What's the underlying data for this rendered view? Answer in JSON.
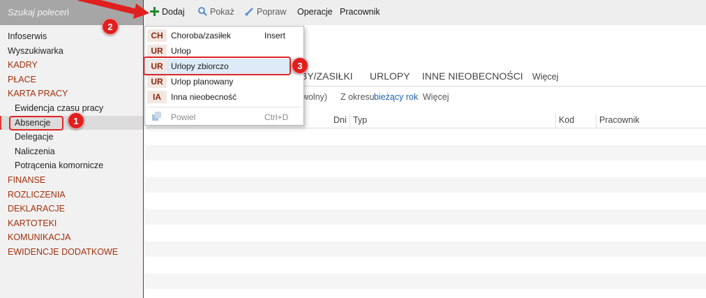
{
  "search": {
    "placeholder": "Szukaj poleceń"
  },
  "sidebar": {
    "items": [
      {
        "label": "Infoserwis"
      },
      {
        "label": "Wyszukiwarka"
      },
      {
        "label": "KADRY"
      },
      {
        "label": "PŁACE"
      },
      {
        "label": "KARTA PRACY"
      },
      {
        "label": "Ewidencja czasu pracy"
      },
      {
        "label": "Absencje"
      },
      {
        "label": "Delegacje"
      },
      {
        "label": "Naliczenia"
      },
      {
        "label": "Potrącenia komornicze"
      },
      {
        "label": "FINANSE"
      },
      {
        "label": "ROZLICZENIA"
      },
      {
        "label": "DEKLARACJE"
      },
      {
        "label": "KARTOTEKI"
      },
      {
        "label": "KOMUNIKACJA"
      },
      {
        "label": "EWIDENCJE DODATKOWE"
      }
    ]
  },
  "toolbar": {
    "add_label": "Dodaj",
    "show_label": "Pokaż",
    "edit_label": "Popraw",
    "operations_label": "Operacje",
    "employee_label": "Pracownik"
  },
  "menu": {
    "items": [
      {
        "code": "CH",
        "label": "Choroba/zasiłek",
        "shortcut": "Insert"
      },
      {
        "code": "UR",
        "label": "Urlop",
        "shortcut": ""
      },
      {
        "code": "UR",
        "label": "Urlopy zbiorczo",
        "shortcut": ""
      },
      {
        "code": "UR",
        "label": "Urlop planowany",
        "shortcut": ""
      },
      {
        "code": "IA",
        "label": "Inna nieobecność",
        "shortcut": ""
      }
    ],
    "duplicate": {
      "label": "Powiel",
      "shortcut": "Ctrl+D"
    }
  },
  "main": {
    "tabs": [
      {
        "label": "BY/ZASIŁKI"
      },
      {
        "label": "URLOPY"
      },
      {
        "label": "INNE NIEOBECNOŚCI"
      },
      {
        "label": "Więcej"
      }
    ],
    "filter": {
      "prefix": "owolny)",
      "period_label": "Z okresu",
      "period_value": "bieżący rok",
      "more": "Więcej"
    },
    "columns": [
      "Dni",
      "Typ",
      "Kod",
      "Pracownik"
    ]
  },
  "annotations": {
    "badges": [
      "1",
      "2",
      "3"
    ],
    "color": "#e01f1f"
  }
}
